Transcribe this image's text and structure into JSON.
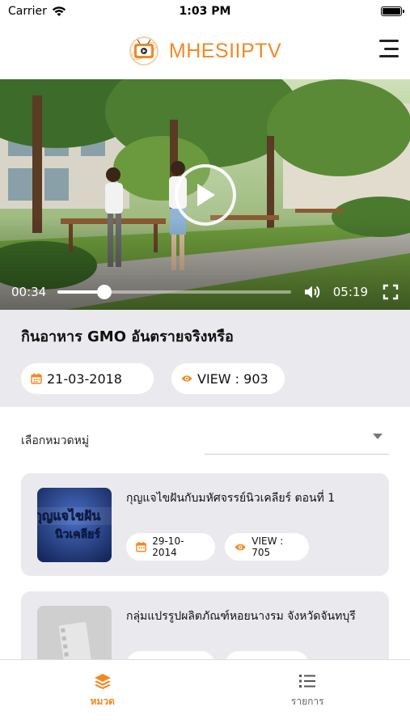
{
  "status_bar": {
    "carrier": "Carrier",
    "time": "1:03 PM",
    "battery_level": 1.0
  },
  "header": {
    "app_title": "MHESIIPTV",
    "brand_color": "#f08a24",
    "logo_icon": "tv-logo-icon",
    "menu_icon": "hamburger-menu-icon"
  },
  "player": {
    "current_time": "00:34",
    "total_time": "05:19",
    "progress": 0.2,
    "play_icon": "play-icon",
    "volume_icon": "speaker-icon",
    "fullscreen_icon": "fullscreen-icon"
  },
  "video_info": {
    "title": "กินอาหาร GMO อันตรายจริงหรือ",
    "date": "21-03-2018",
    "views": "VIEW : 903"
  },
  "category": {
    "label": "เลือกหมวดหมู่",
    "selected": ""
  },
  "items": [
    {
      "title": "กุญแจไขฝันกับมหัศจรรย์นิวเคลียร์ ตอนที่ 1",
      "date": "29-10-2014",
      "views": "VIEW : 705",
      "thumb_text_top": "กุญแจไขฝัน",
      "thumb_text_bottom": "นิวเคลียร์"
    },
    {
      "title": "กลุ่มแปรรูปผลิตภัณฑ์หอยนางรม จังหวัดจันทบุรี",
      "date": "",
      "views": ""
    }
  ],
  "tabs": [
    {
      "label": "หมวด",
      "icon": "layers-icon",
      "active": true
    },
    {
      "label": "รายการ",
      "icon": "list-icon",
      "active": false
    }
  ]
}
